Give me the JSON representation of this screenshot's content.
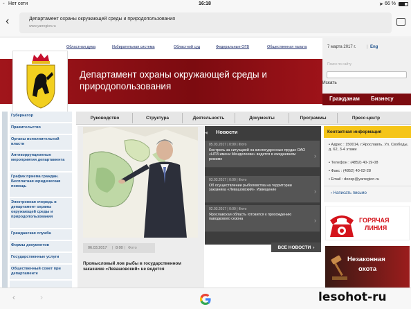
{
  "status_bar": {
    "carrier": "Нет сети",
    "time": "16:18",
    "battery": "66 %"
  },
  "browser": {
    "page_title": "Департамент охраны окружающей среды и природопользования",
    "url": "www.yarregion.ru"
  },
  "top_links": [
    "Областная дума",
    "Избирательная система",
    "Областной суд",
    "Федеральные ОГВ",
    "Общественная палата"
  ],
  "date": "7 марта 2017 г.",
  "lang": "Eng",
  "search": {
    "placeholder": "Поиск по сайту",
    "button": "Искать"
  },
  "header_title_line1": "Департамент охраны окружающей среды и",
  "header_title_line2": "природопользования",
  "header_buttons": [
    "Гражданам",
    "Бизнесу"
  ],
  "nav_tabs": [
    "Руководство",
    "Структура",
    "Деятельность",
    "Документы",
    "Программы",
    "Пресс-центр"
  ],
  "sidebar": [
    "Губернатор",
    "Правительство",
    "Органы исполнительной власти",
    "Антикоррупционные мероприятия департамента",
    "График приема граждан. Бесплатная юридическая помощь",
    "Электронная очередь в департамент охраны окружающей среды и природопользования",
    "Гражданская служба",
    "Формы документов",
    "Государственные услуги",
    "Общественный совет при департаменте"
  ],
  "feature": {
    "date": "06.03.2017",
    "time": "8:00",
    "type": "Фото",
    "caption": "Промысловый лов рыбы в государственном заказнике «Левашовский» не ведется"
  },
  "news": {
    "title": "Новости",
    "items": [
      {
        "date": "05.03.2017",
        "time": "0:00",
        "type": "Фото",
        "text": "Контроль за ситуацией на кислогудронных прудах ОАО «НПЗ имени Менделеева» ведется в ежедневном режиме"
      },
      {
        "date": "03.03.2017",
        "time": "0:00",
        "type": "Фото",
        "text": "Об осуществлении рыболовства на территории заказника «Левашовский». Извещение"
      },
      {
        "date": "02.03.2017",
        "time": "0:00",
        "type": "Фото",
        "text": "Ярославская область готовится к прохождению паводкового сезона"
      }
    ],
    "all_button": "ВСЕ НОВОСТИ"
  },
  "contact": {
    "title": "Контактная информация",
    "address": "Адрес : 150014, г.Ярославль, Ул. Свободы, д. 62, 3-4 этажи",
    "phone": "Телефон : (4852) 40-19-08",
    "fax": "Факс : (4852) 40-02-28",
    "email": "Email : doosp@yarregion.ru",
    "write": "Написать письмо"
  },
  "banners": {
    "hotline_1": "ГОРЯЧАЯ",
    "hotline_2": "ЛИНИЯ",
    "illegal_1": "Незаконная",
    "illegal_2": "охота"
  },
  "watermark": "lesohot-ru",
  "colors": {
    "header_red": "#8b0d12",
    "nav_grey": "#e6e6e6",
    "news_dark": "#3d3d3d",
    "contact_yellow": "#f5c518",
    "link_blue": "#1b4f8a"
  }
}
